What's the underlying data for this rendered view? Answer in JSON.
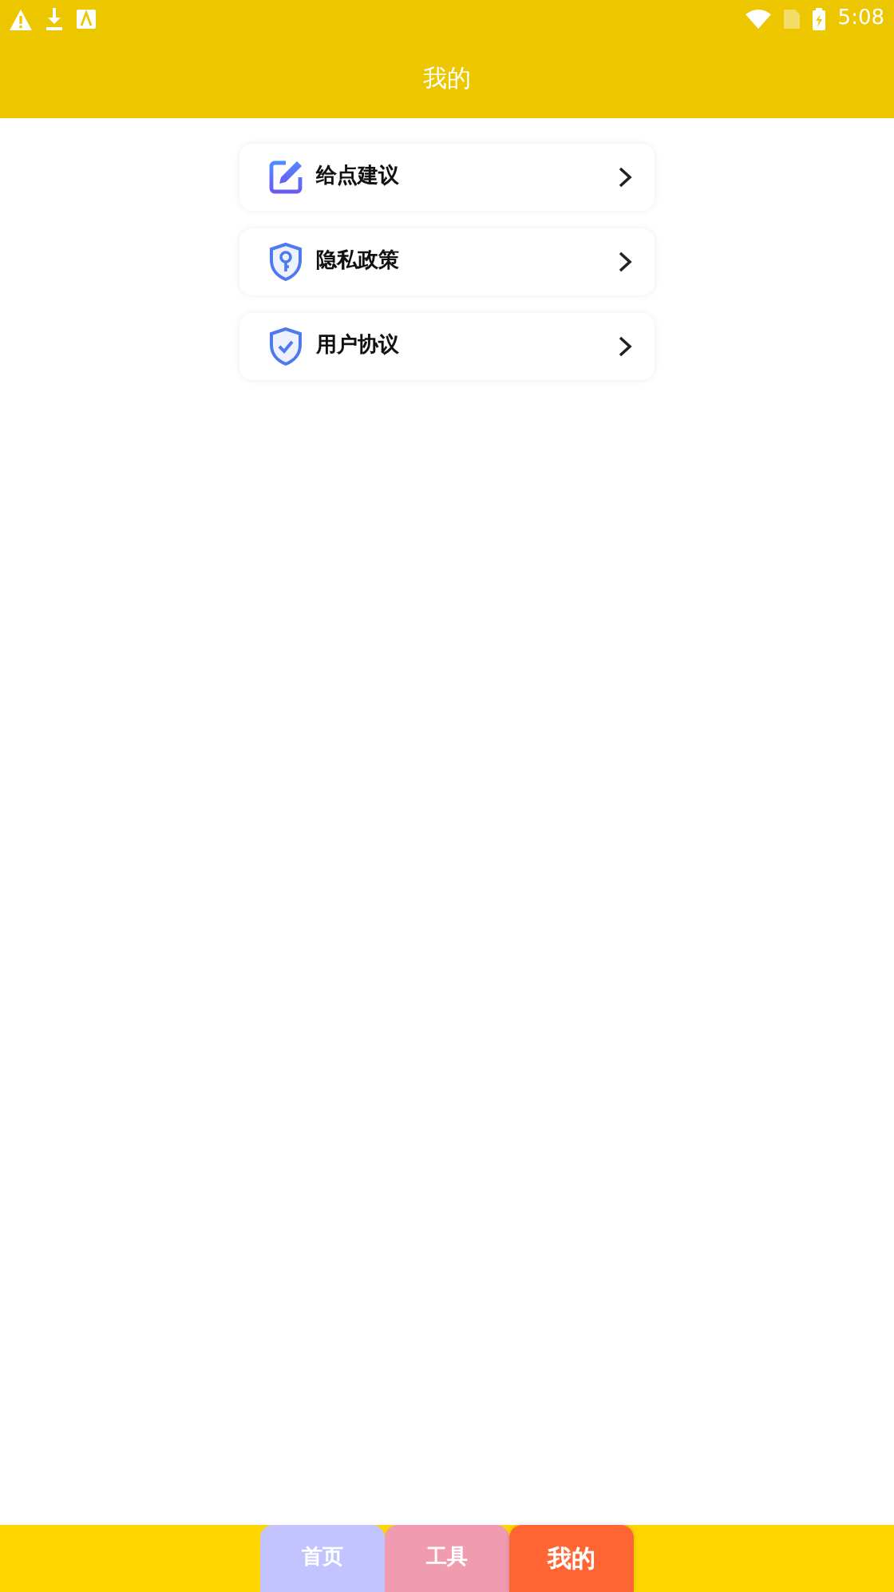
{
  "status_bar": {
    "time": "5:08"
  },
  "header": {
    "title": "我的"
  },
  "menu": [
    {
      "kind": "feedback",
      "label": "给点建议"
    },
    {
      "kind": "privacy",
      "label": "隐私政策"
    },
    {
      "kind": "agreement",
      "label": "用户协议"
    }
  ],
  "tabs": [
    {
      "label": "首页",
      "selected": false,
      "color": "#c3c3ff"
    },
    {
      "label": "工具",
      "selected": false,
      "color": "#f19bb0"
    },
    {
      "label": "我的",
      "selected": true,
      "color": "#ff6633"
    }
  ]
}
